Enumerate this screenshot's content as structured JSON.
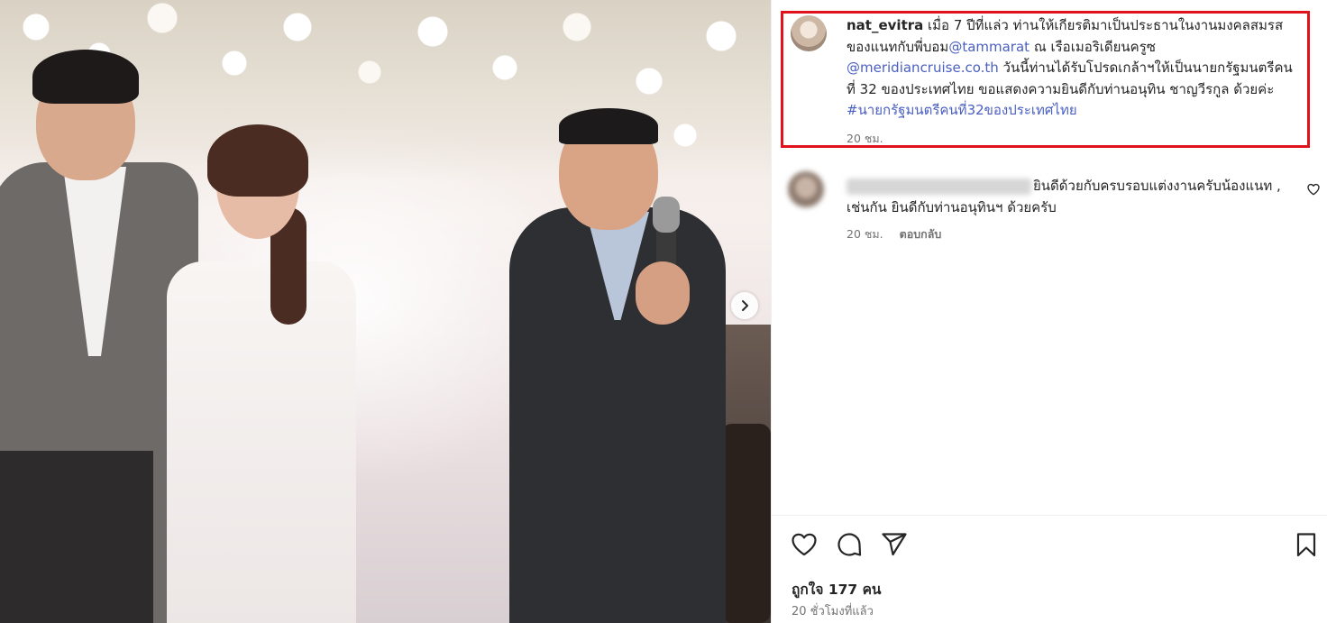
{
  "post": {
    "username": "nat_evitra",
    "caption_part1": " เมื่อ 7 ปีที่แล่ว ท่านให้เกียรติมาเป็นประธานในงานมงคลสมรสของแนทกับพี่บอม",
    "mention1": "@tammarat",
    "caption_part2": " ณ เรือเมอริเดียนครูซ ",
    "mention2": "@meridiancruise.co.th",
    "caption_part3": " วันนี้ท่านได้รับโปรดเกล้าฯให้เป็นนายกรัฐมนตรีคนที่ 32 ของประเทศไทย ขอแสดงความยินดีกับท่านอนุทิน ชาญวีรกูล ด้วยค่ะ ",
    "hashtag": "#นายกรัฐมนตรีคนที่32ของประเทศไทย",
    "time": "20 ชม."
  },
  "comment": {
    "text": "ยินดีด้วยกับครบรอบแต่งงานครับน้องแนท , เช่นกัน ยินดีกับท่านอนุทินฯ ด้วยครับ",
    "time": "20 ชม.",
    "reply_label": "ตอบกลับ"
  },
  "footer": {
    "likes": "ถูกใจ 177 คน",
    "posted": "20 ชั่วโมงที่แล้ว"
  },
  "icons": {
    "like": "heart-icon",
    "comment": "comment-bubble-icon",
    "share": "paper-plane-icon",
    "save": "bookmark-icon",
    "next": "chevron-right-icon"
  },
  "colors": {
    "highlight_border": "#e0121b",
    "link": "#4a5fc1",
    "secondary_text": "#737373"
  }
}
